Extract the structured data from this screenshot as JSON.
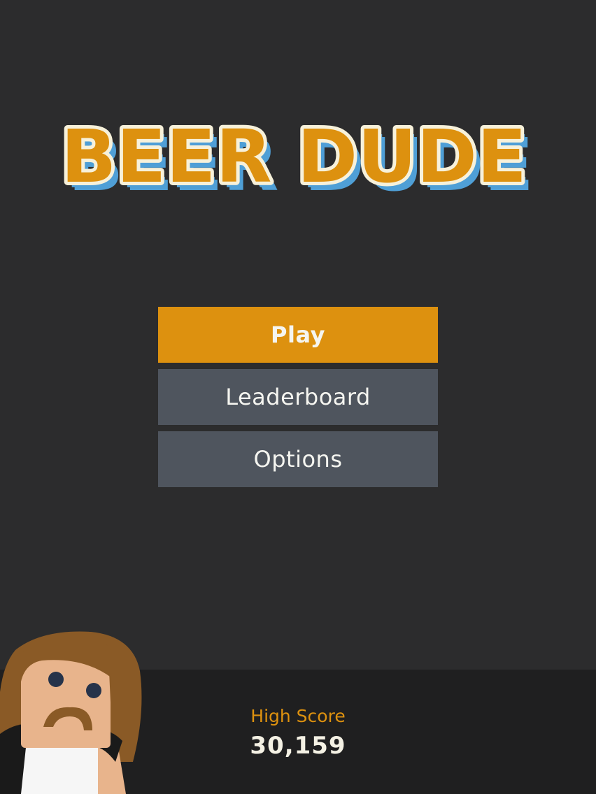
{
  "title": {
    "text": "BEER DUDE"
  },
  "menu": {
    "play_label": "Play",
    "leaderboard_label": "Leaderboard",
    "options_label": "Options"
  },
  "footer": {
    "high_score_label": "High Score",
    "high_score_value": "30,159"
  },
  "character": {
    "icon": "beer-dude-character-icon"
  },
  "colors": {
    "background": "#2c2c2d",
    "footer_background": "#1f1f20",
    "accent_orange": "#dd910f",
    "button_gray": "#4f555e",
    "title_shadow_blue": "#4f9fd6",
    "title_outline_cream": "#f7f1da",
    "text_light": "#f5f5f0"
  }
}
